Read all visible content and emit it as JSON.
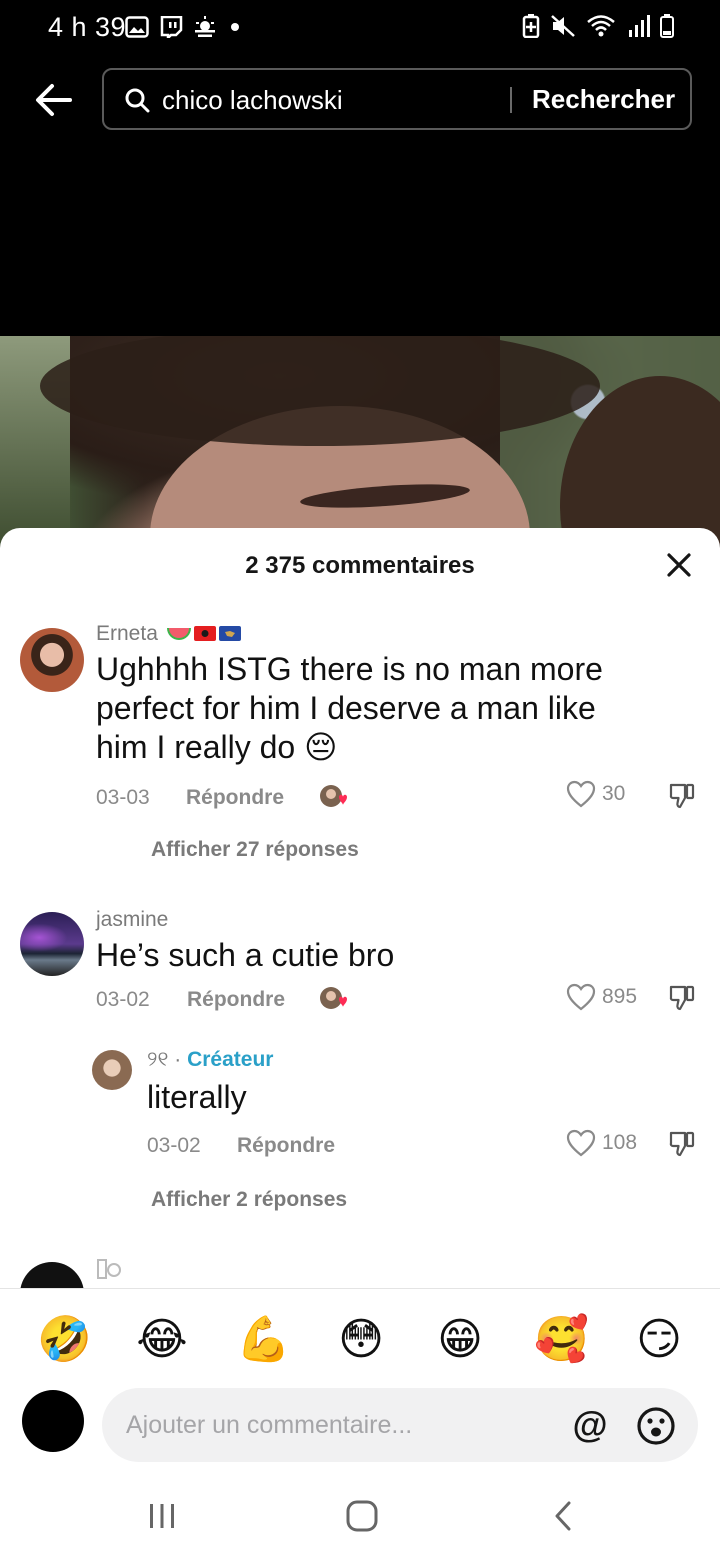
{
  "status_bar": {
    "time": "4 h 39",
    "left_icons": [
      "gallery-icon",
      "twitch-icon",
      "weather-icon",
      "dot-icon"
    ],
    "right_icons": [
      "battery-saver-icon",
      "mute-icon",
      "wifi-icon",
      "signal-icon",
      "battery-icon"
    ]
  },
  "search": {
    "query": "chico lachowski",
    "submit_label": "Rechercher"
  },
  "comments_panel": {
    "title": "2 375 commentaires",
    "comments": [
      {
        "author": "Erneta",
        "author_badges": [
          "watermelon-icon",
          "albania-flag-icon",
          "kosovo-flag-icon"
        ],
        "text_line1": "Ughhhh ISTG there is no man more",
        "text_line2": "perfect for him I deserve a man like",
        "text_line3": "him I really do",
        "text_emoji": "😔",
        "date": "03-03",
        "reply_label": "Répondre",
        "likes": "30",
        "view_replies": "Afficher 27 réponses"
      },
      {
        "author": "jasmine",
        "text": "He’s such a cutie bro",
        "date": "03-02",
        "reply_label": "Répondre",
        "likes": "895",
        "reply": {
          "author": "୨୧",
          "separator": "·",
          "creator_label": "Créateur",
          "text": "literally",
          "date": "03-02",
          "reply_label": "Répondre",
          "likes": "108"
        },
        "view_replies": "Afficher 2 réponses"
      }
    ],
    "emoji_bar": [
      "🤣",
      "😂",
      "💪",
      "😳",
      "😁",
      "🥰",
      "😏"
    ],
    "composer": {
      "placeholder": "Ajouter un commentaire...",
      "mention_label": "@"
    }
  },
  "colors": {
    "accent_creator": "#2aa0c8",
    "like_heart": "#fe2c55"
  }
}
